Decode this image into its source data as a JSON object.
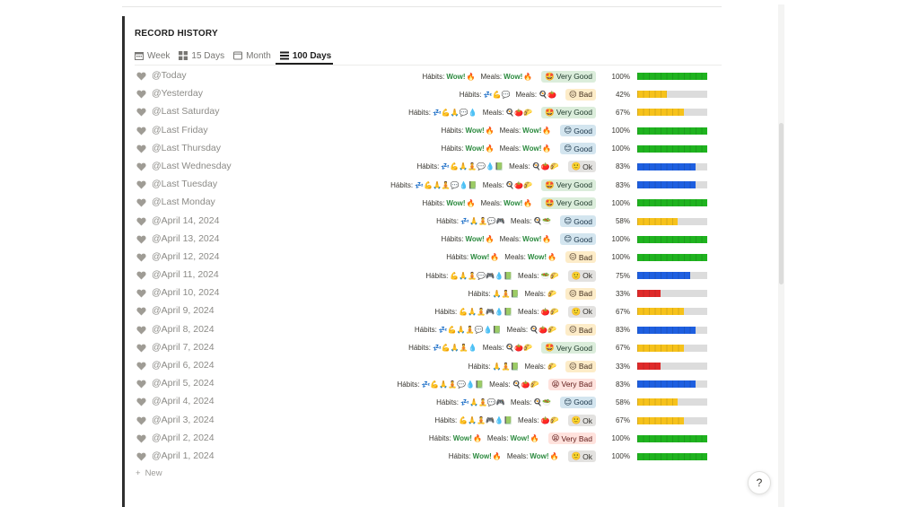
{
  "section_title": "RECORD HISTORY",
  "tabs": [
    {
      "label": "Week",
      "icon": "calendar-icon",
      "active": false
    },
    {
      "label": "15 Days",
      "icon": "grid-icon",
      "active": false
    },
    {
      "label": "Month",
      "icon": "window-icon",
      "active": false
    },
    {
      "label": "100 Days",
      "icon": "list-icon",
      "active": true
    }
  ],
  "labels": {
    "habits": "Hábits:",
    "meals": "Meals:",
    "wow": "Wow!",
    "fire": "🔥"
  },
  "colors": {
    "green": "#1fb31f",
    "yellow": "#f6c21b",
    "blue": "#1e5fe0",
    "red": "#df2a2a"
  },
  "rows": [
    {
      "date": "@Today",
      "habits": "wow",
      "meals": "wow",
      "rating": "Very Good",
      "rating_emoji": "🤩",
      "pct": "100%",
      "value": 1.0,
      "color": "green"
    },
    {
      "date": "@Yesterday",
      "habits": "💤💪💬",
      "meals": "🍳🍅",
      "rating": "Bad",
      "rating_emoji": "😖",
      "pct": "42%",
      "value": 0.42,
      "color": "yellow"
    },
    {
      "date": "@Last Saturday",
      "habits": "💤💪🙏💬💧",
      "meals": "🍳🍅🌮",
      "rating": "Very Good",
      "rating_emoji": "🤩",
      "pct": "67%",
      "value": 0.67,
      "color": "yellow"
    },
    {
      "date": "@Last Friday",
      "habits": "wow",
      "meals": "wow",
      "rating": "Good",
      "rating_emoji": "😊",
      "pct": "100%",
      "value": 1.0,
      "color": "green"
    },
    {
      "date": "@Last Thursday",
      "habits": "wow",
      "meals": "wow",
      "rating": "Good",
      "rating_emoji": "😊",
      "pct": "100%",
      "value": 1.0,
      "color": "green"
    },
    {
      "date": "@Last Wednesday",
      "habits": "💤💪🙏🧘💬💧📗",
      "meals": "🍳🍅🌮",
      "rating": "Ok",
      "rating_emoji": "🙂",
      "pct": "83%",
      "value": 0.83,
      "color": "blue"
    },
    {
      "date": "@Last Tuesday",
      "habits": "💤💪🙏🧘💬💧📗",
      "meals": "🍳🍅🌮",
      "rating": "Very Good",
      "rating_emoji": "🤩",
      "pct": "83%",
      "value": 0.83,
      "color": "blue"
    },
    {
      "date": "@Last Monday",
      "habits": "wow",
      "meals": "wow",
      "rating": "Very Good",
      "rating_emoji": "🤩",
      "pct": "100%",
      "value": 1.0,
      "color": "green"
    },
    {
      "date": "@April 14, 2024",
      "habits": "💤🙏🧘💬🎮",
      "meals": "🍳🥗",
      "rating": "Good",
      "rating_emoji": "😊",
      "pct": "58%",
      "value": 0.58,
      "color": "yellow"
    },
    {
      "date": "@April 13, 2024",
      "habits": "wow",
      "meals": "wow",
      "rating": "Good",
      "rating_emoji": "😊",
      "pct": "100%",
      "value": 1.0,
      "color": "green"
    },
    {
      "date": "@April 12, 2024",
      "habits": "wow",
      "meals": "wow",
      "rating": "Bad",
      "rating_emoji": "😖",
      "pct": "100%",
      "value": 1.0,
      "color": "green"
    },
    {
      "date": "@April 11, 2024",
      "habits": "💪🙏🧘💬🎮💧📗",
      "meals": "🥗🌮",
      "rating": "Ok",
      "rating_emoji": "🙂",
      "pct": "75%",
      "value": 0.75,
      "color": "blue"
    },
    {
      "date": "@April 10, 2024",
      "habits": "🙏🧘📗",
      "meals": "🌮",
      "rating": "Bad",
      "rating_emoji": "😖",
      "pct": "33%",
      "value": 0.33,
      "color": "red"
    },
    {
      "date": "@April 9, 2024",
      "habits": "💪🙏🧘🎮💧📗",
      "meals": "🍅🌮",
      "rating": "Ok",
      "rating_emoji": "🙂",
      "pct": "67%",
      "value": 0.67,
      "color": "yellow"
    },
    {
      "date": "@April 8, 2024",
      "habits": "💤💪🙏🧘💬💧📗",
      "meals": "🍳🍅🌮",
      "rating": "Bad",
      "rating_emoji": "😖",
      "pct": "83%",
      "value": 0.83,
      "color": "blue"
    },
    {
      "date": "@April 7, 2024",
      "habits": "💤💪🙏🧘💧",
      "meals": "🍳🍅🌮",
      "rating": "Very Good",
      "rating_emoji": "🤩",
      "pct": "67%",
      "value": 0.67,
      "color": "yellow"
    },
    {
      "date": "@April 6, 2024",
      "habits": "🙏🧘📗",
      "meals": "🌮",
      "rating": "Bad",
      "rating_emoji": "😖",
      "pct": "33%",
      "value": 0.33,
      "color": "red"
    },
    {
      "date": "@April 5, 2024",
      "habits": "💤💪🙏🧘💬💧📗",
      "meals": "🍳🍅🌮",
      "rating": "Very Bad",
      "rating_emoji": "😫",
      "pct": "83%",
      "value": 0.83,
      "color": "blue"
    },
    {
      "date": "@April 4, 2024",
      "habits": "💤🙏🧘💬🎮",
      "meals": "🍳🥗",
      "rating": "Good",
      "rating_emoji": "😊",
      "pct": "58%",
      "value": 0.58,
      "color": "yellow"
    },
    {
      "date": "@April 3, 2024",
      "habits": "💪🙏🧘🎮💧📗",
      "meals": "🍅🌮",
      "rating": "Ok",
      "rating_emoji": "🙂",
      "pct": "67%",
      "value": 0.67,
      "color": "yellow"
    },
    {
      "date": "@April 2, 2024",
      "habits": "wow",
      "meals": "wow",
      "rating": "Very Bad",
      "rating_emoji": "😫",
      "pct": "100%",
      "value": 1.0,
      "color": "green"
    },
    {
      "date": "@April 1, 2024",
      "habits": "wow",
      "meals": "wow",
      "rating": "Ok",
      "rating_emoji": "🙂",
      "pct": "100%",
      "value": 1.0,
      "color": "green"
    }
  ],
  "new_label": "New",
  "help_label": "?"
}
